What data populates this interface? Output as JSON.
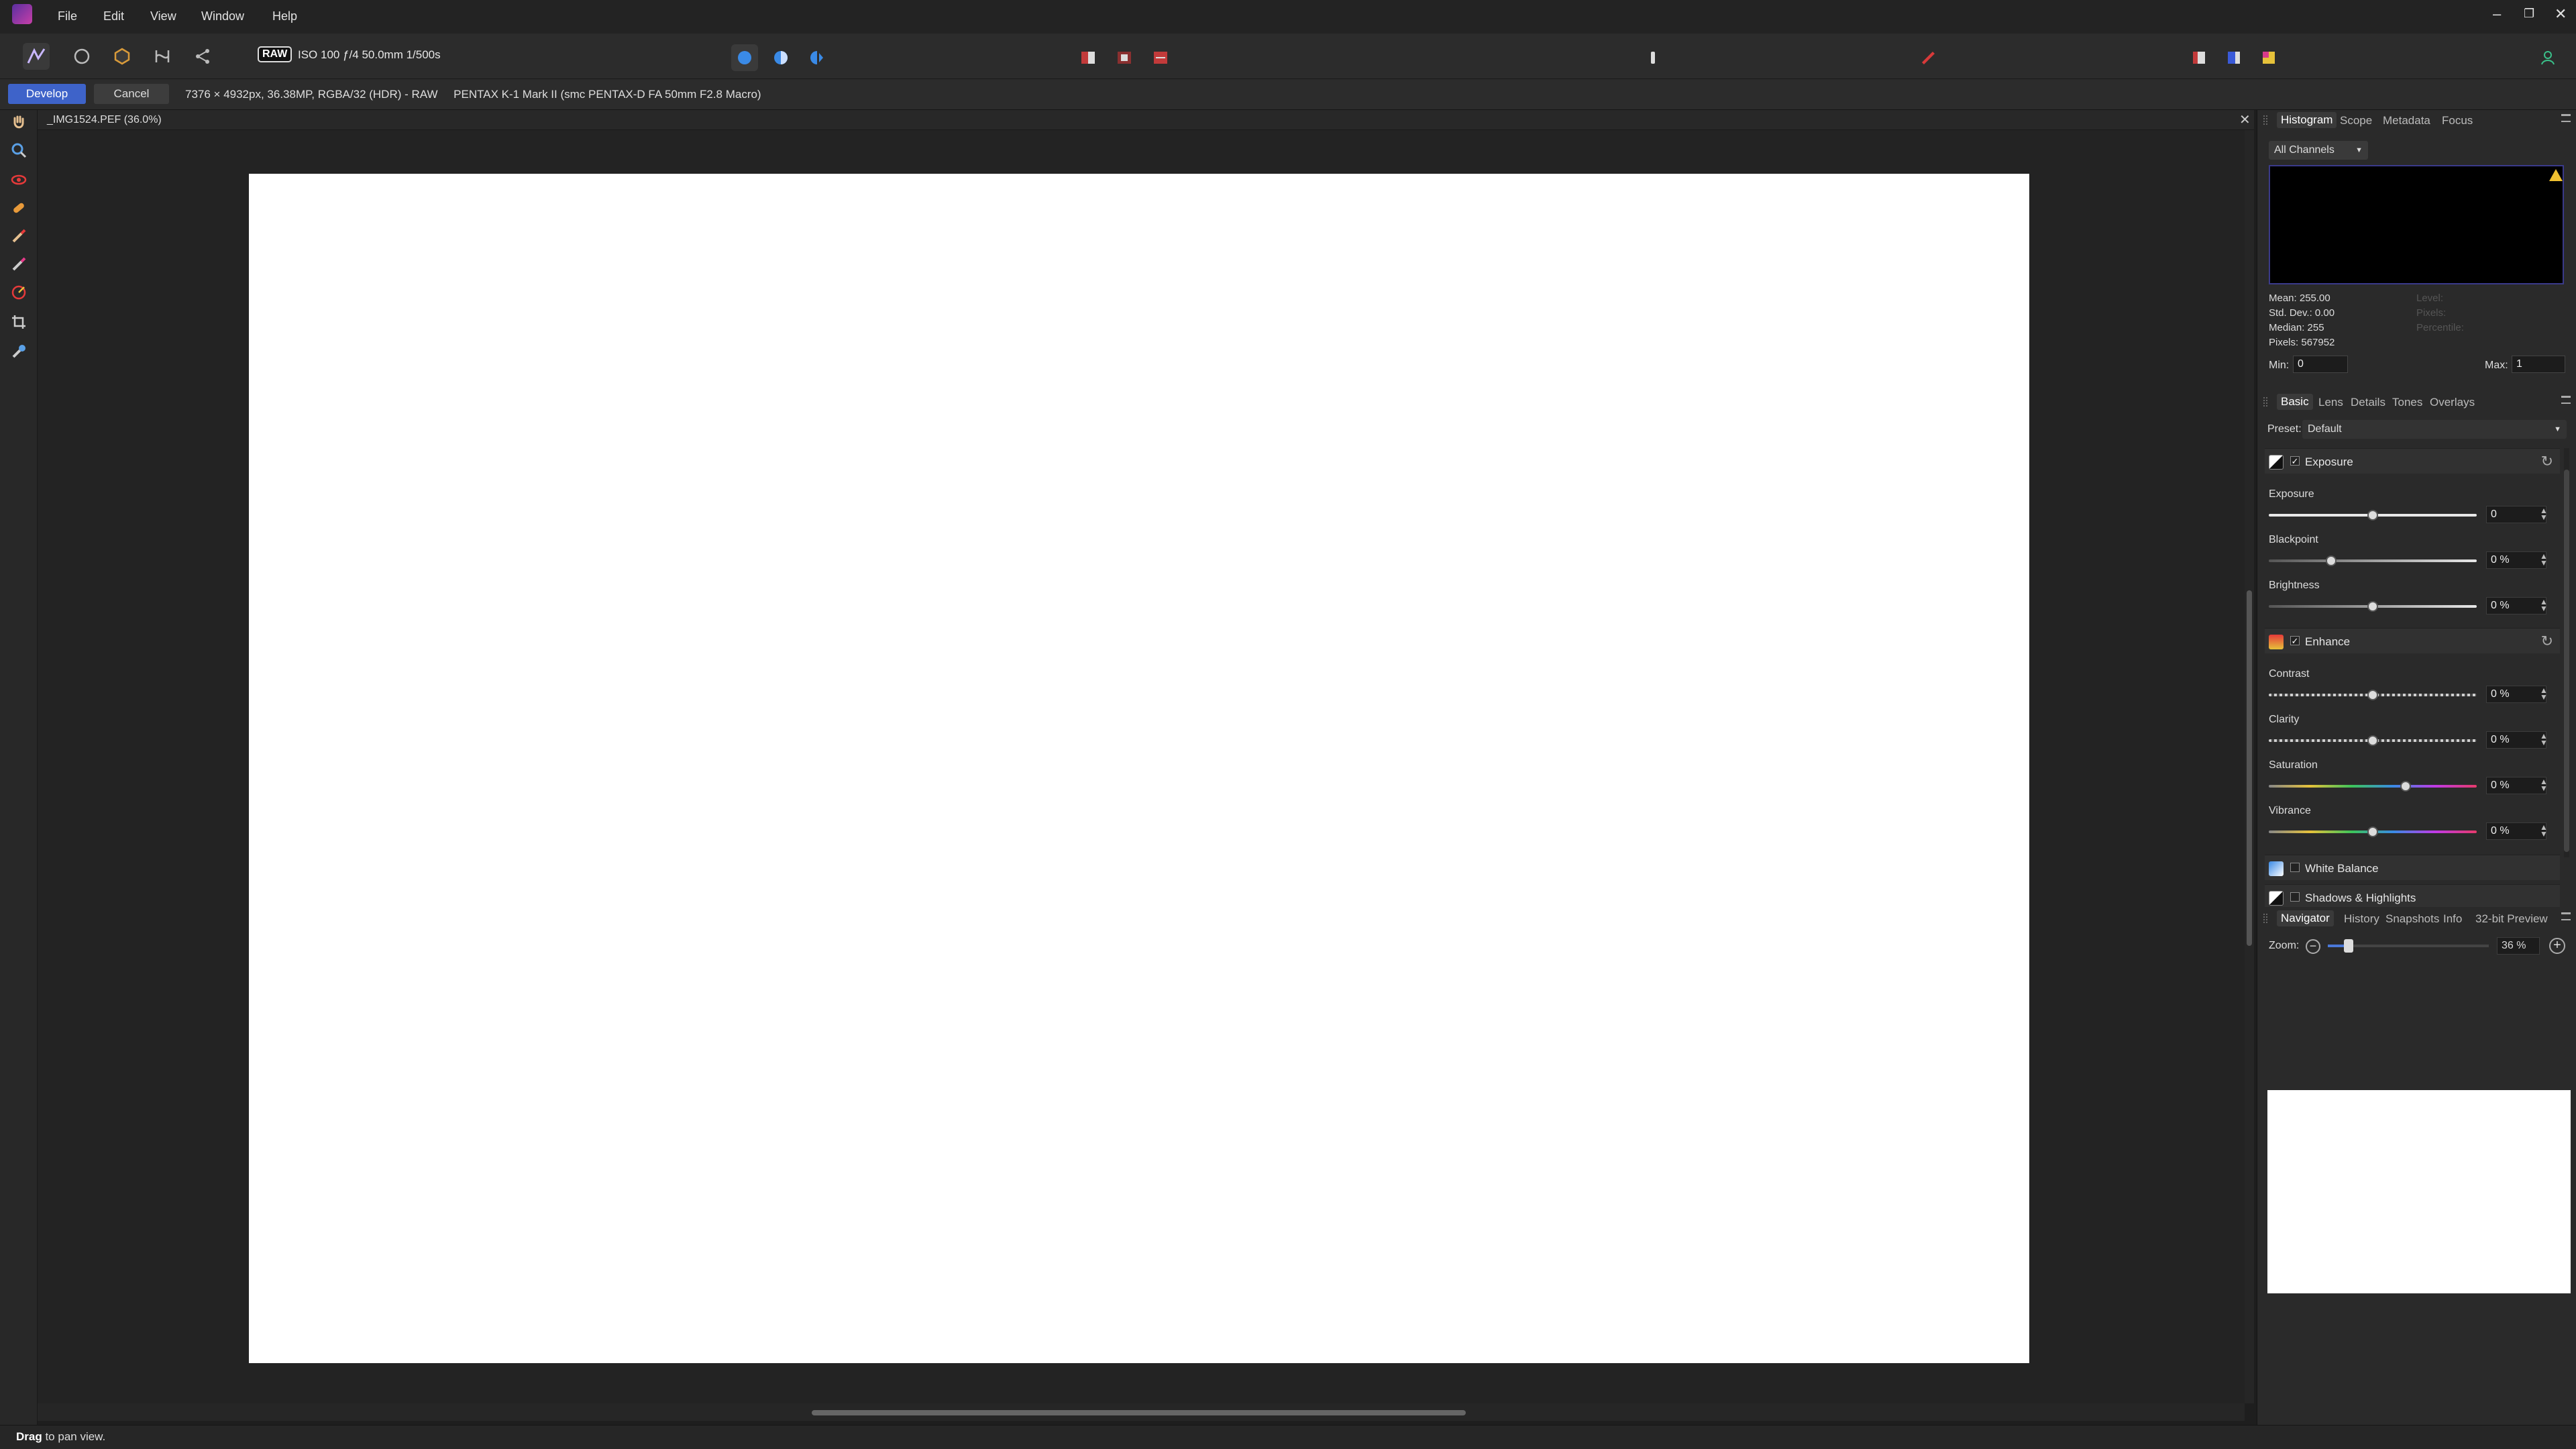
{
  "menubar": {
    "items": [
      "File",
      "Edit",
      "View",
      "Window",
      "Help"
    ]
  },
  "toolbar": {
    "raw_badge": "RAW",
    "camera_info": "ISO 100 ƒ/4 50.0mm 1/500s"
  },
  "context": {
    "develop_label": "Develop",
    "cancel_label": "Cancel",
    "image_info": "7376 × 4932px, 36.38MP, RGBA/32 (HDR) - RAW     PENTAX K-1 Mark II (smc PENTAX-D FA 50mm F2.8 Macro)"
  },
  "document": {
    "tab_title": "_IMG1524.PEF (36.0%)"
  },
  "histogram_panel": {
    "tabs": [
      "Histogram",
      "Scope",
      "Metadata",
      "Focus"
    ],
    "channel": "All Channels",
    "stats": [
      "Mean: 255.00",
      "Std. Dev.: 0.00",
      "Median: 255",
      "Pixels: 567952"
    ],
    "stats_dim": [
      "Level:",
      "Pixels:",
      "Percentile:"
    ],
    "min_label": "Min:",
    "min_value": "0",
    "max_label": "Max:",
    "max_value": "1"
  },
  "develop_panel": {
    "tabs": [
      "Basic",
      "Lens",
      "Details",
      "Tones",
      "Overlays"
    ],
    "preset_label": "Preset:",
    "preset_value": "Default",
    "groups": {
      "exposure": {
        "title": "Exposure",
        "sliders": [
          {
            "label": "Exposure",
            "value": "0",
            "position": 0.5
          },
          {
            "label": "Blackpoint",
            "value": "0 %",
            "position": 0.3
          },
          {
            "label": "Brightness",
            "value": "0 %",
            "position": 0.5
          }
        ]
      },
      "enhance": {
        "title": "Enhance",
        "sliders": [
          {
            "label": "Contrast",
            "value": "0 %",
            "position": 0.5
          },
          {
            "label": "Clarity",
            "value": "0 %",
            "position": 0.5
          },
          {
            "label": "Saturation",
            "value": "0 %",
            "position": 0.66
          },
          {
            "label": "Vibrance",
            "value": "0 %",
            "position": 0.5
          }
        ]
      },
      "white_balance": {
        "title": "White Balance"
      },
      "shadows_highlights": {
        "title": "Shadows & Highlights"
      }
    }
  },
  "navigator_panel": {
    "tabs": [
      "Navigator",
      "History",
      "Snapshots",
      "Info",
      "32-bit Preview"
    ],
    "zoom_label": "Zoom:",
    "zoom_value": "36 %"
  },
  "status": {
    "bold": "Drag",
    "rest": " to pan view."
  },
  "colors": {
    "accent": "#3e63c9",
    "histogram_warning": "#f0c030"
  }
}
